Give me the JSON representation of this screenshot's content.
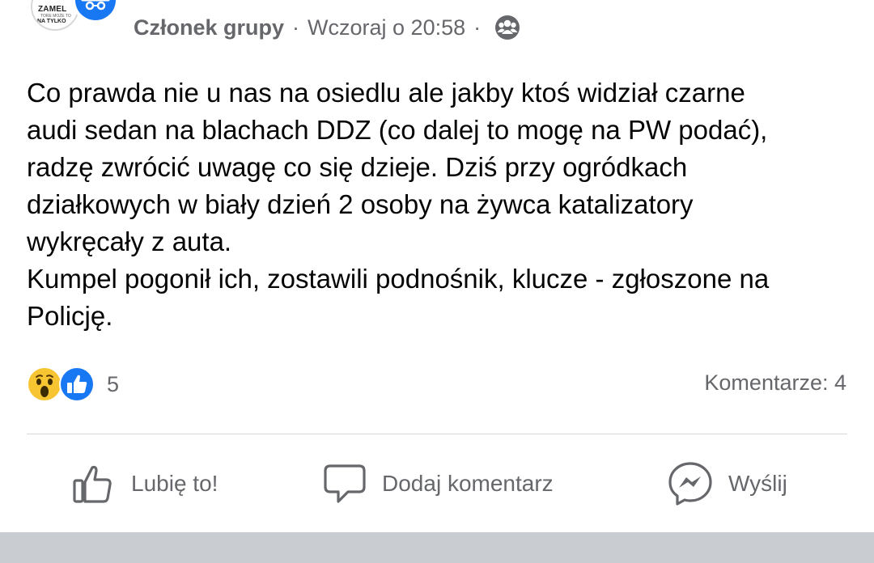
{
  "post": {
    "author_meta": "Członek grupy",
    "separator": "·",
    "timestamp": "Wczoraj o 20:58",
    "privacy_icon": "group-members-icon",
    "avatar_text_top": "ZAMEL",
    "avatar_text_mid": "TORE MOŻE TO",
    "avatar_text_bottom": "NA TYLKO",
    "badge_icon": "anonymous-member-icon",
    "text": "Co prawda nie u nas na osiedlu ale jakby ktoś widział czarne\naudi sedan na blachach DDZ (co dalej to mogę na PW podać),\nradzę zwrócić uwagę co się dzieje. Dziś przy ogródkach\ndziałkowych w biały dzień 2 osoby na żywca katalizatory\nwykręcały z auta.\nKumpel pogonił ich, zostawili podnośnik, klucze - zgłoszone na\nPolicję."
  },
  "reactions": {
    "icons": [
      "wow-reaction-icon",
      "like-reaction-icon"
    ],
    "count": "5",
    "comments": "Komentarze: 4"
  },
  "actions": {
    "like": "Lubię to!",
    "comment": "Dodaj komentarz",
    "send": "Wyślij"
  },
  "colors": {
    "meta_text": "#65676b",
    "body_text": "#050505",
    "like_blue": "#1877f2",
    "wow_yellow": "#f7c531",
    "page_gray": "#c9ccd1"
  }
}
